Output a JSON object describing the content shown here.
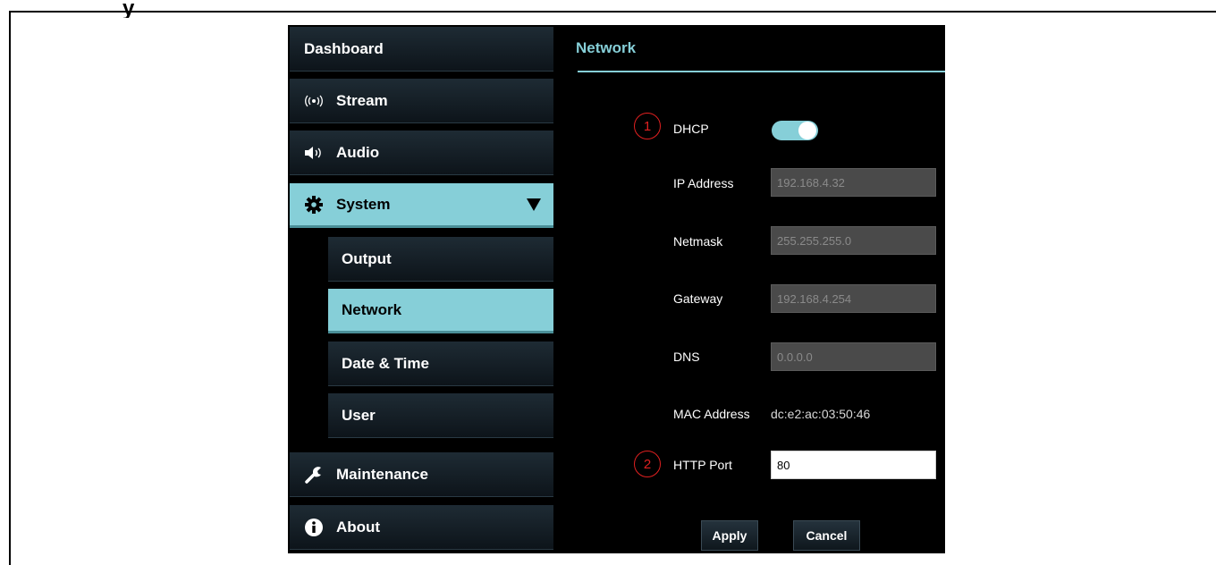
{
  "sidebar": {
    "items": [
      {
        "label": "Dashboard",
        "icon": ""
      },
      {
        "label": "Stream",
        "icon": "broadcast-icon"
      },
      {
        "label": "Audio",
        "icon": "speaker-icon"
      },
      {
        "label": "System",
        "icon": "gear-icon",
        "expanded": true,
        "active": true
      },
      {
        "label": "Maintenance",
        "icon": "wrench-icon"
      },
      {
        "label": "About",
        "icon": "info-icon"
      }
    ],
    "system_children": [
      {
        "label": "Output"
      },
      {
        "label": "Network",
        "active": true
      },
      {
        "label": "Date & Time"
      },
      {
        "label": "User"
      }
    ]
  },
  "network": {
    "title": "Network",
    "dhcp": {
      "label": "DHCP",
      "enabled": true,
      "marker": "1"
    },
    "ip_address": {
      "label": "IP Address",
      "value": "192.168.4.32"
    },
    "netmask": {
      "label": "Netmask",
      "value": "255.255.255.0"
    },
    "gateway": {
      "label": "Gateway",
      "value": "192.168.4.254"
    },
    "dns": {
      "label": "DNS",
      "value": "0.0.0.0"
    },
    "mac_address": {
      "label": "MAC Address",
      "value": "dc:e2:ac:03:50:46"
    },
    "http_port": {
      "label": "HTTP Port",
      "value": "80",
      "marker": "2"
    },
    "apply_label": "Apply",
    "cancel_label": "Cancel"
  },
  "colors": {
    "accent": "#86cfd8",
    "background": "#000000",
    "marker": "#e02020"
  }
}
